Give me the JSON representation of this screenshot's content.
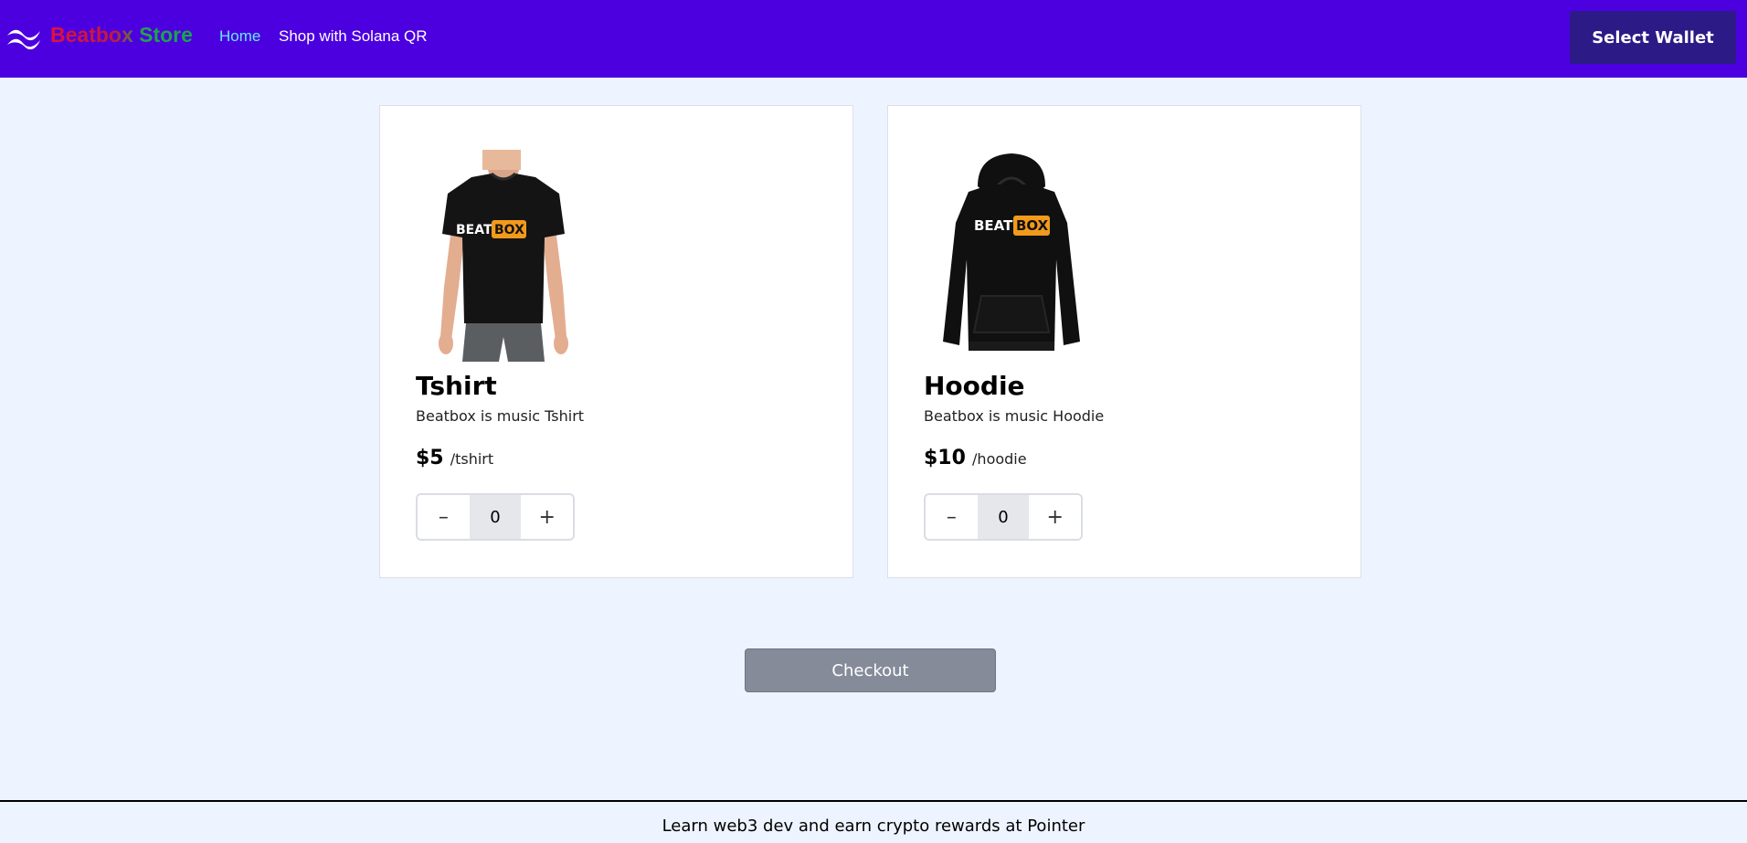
{
  "header": {
    "brand": "Beatbox Store",
    "logo_icon": "wave-logo-icon",
    "nav": [
      {
        "label": "Home",
        "active": true,
        "color": "#67e8f9"
      },
      {
        "label": "Shop with Solana QR",
        "active": false,
        "color": "#ffffff"
      }
    ],
    "wallet_button": "Select Wallet",
    "background": "#4c00e0"
  },
  "products": [
    {
      "title": "Tshirt",
      "description": "Beatbox is music Tshirt",
      "price": "$5",
      "unit": "/tshirt",
      "quantity": "0",
      "image_text": [
        "BEAT",
        "BOX"
      ],
      "image_icon": "tshirt-product-image"
    },
    {
      "title": "Hoodie",
      "description": "Beatbox is music Hoodie",
      "price": "$10",
      "unit": "/hoodie",
      "quantity": "0",
      "image_text": [
        "BEAT",
        "BOX"
      ],
      "image_icon": "hoodie-product-image"
    }
  ],
  "stepper": {
    "decrement_icon": "minus-icon",
    "increment_icon": "plus-icon",
    "decrement_glyph": "–",
    "increment_glyph": "+"
  },
  "checkout": {
    "label": "Checkout"
  },
  "footer": {
    "text": "Learn web3 dev and earn crypto rewards at Pointer"
  },
  "colors": {
    "page_bg": "#eef4ff",
    "accent_orange": "#f29a1b",
    "checkout_bg": "#868b99",
    "wallet_bg": "#2c1a87"
  }
}
